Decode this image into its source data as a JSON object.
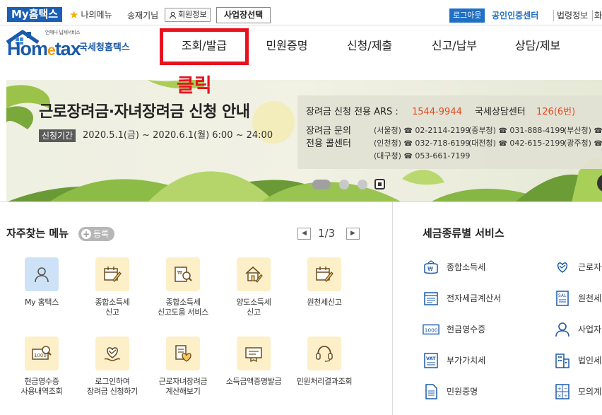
{
  "topbar": {
    "my_hometax": "My홈택스",
    "my_menu": "나의메뉴",
    "user_name": "송재기님",
    "member_info": "회원정보",
    "biz_select": "사업장선택",
    "logout": "로그아웃",
    "cert_center": "공인인증센터",
    "law_info": "법령정보",
    "law_extra": "화"
  },
  "logo": {
    "sub": "언제나 납세서비스",
    "text_a": "Hom",
    "text_e": "e",
    "text_b": "tax",
    "korean": "국세청홈택스"
  },
  "nav": [
    "조회/발급",
    "민원증명",
    "신청/제출",
    "신고/납부",
    "상담/제보"
  ],
  "annotation": {
    "click_note": "클릭"
  },
  "banner": {
    "title": "근로장려금·자녀장려금 신청 안내",
    "period_label": "신청기간",
    "period_text": "2020.5.1(금) ~ 2020.6.1(월) 6:00 ~ 24:00",
    "ars_label": "장려금 신청 전용 ARS :",
    "ars_number": "1544-9944",
    "nts_label": "국세상담센터",
    "nts_number": "126(6번)",
    "call_label_1": "장려금 문의",
    "call_label_2": "전용 콜센터",
    "phones": [
      {
        "region": "(서울청)",
        "number": "02-2114-2199"
      },
      {
        "region": "(중부청)",
        "number": "031-888-4199"
      },
      {
        "region": "(부산청)",
        "number": ""
      },
      {
        "region": "(인천청)",
        "number": "032-718-6199"
      },
      {
        "region": "(대전청)",
        "number": "042-615-2199"
      },
      {
        "region": "(광주청)",
        "number": ""
      },
      {
        "region": "(대구청)",
        "number": "053-661-7199"
      }
    ]
  },
  "favorites": {
    "title": "자주찾는 메뉴",
    "register": "등록",
    "page": "1/3",
    "items": [
      {
        "label_1": "My 홈택스",
        "label_2": "",
        "icon": "person-icon"
      },
      {
        "label_1": "종합소득세",
        "label_2": "신고",
        "icon": "calendar-pen-icon"
      },
      {
        "label_1": "종합소득세",
        "label_2": "신고도움 서비스",
        "icon": "document-search-icon"
      },
      {
        "label_1": "양도소득세",
        "label_2": "신고",
        "icon": "house-pen-icon"
      },
      {
        "label_1": "원천세신고",
        "label_2": "",
        "icon": "calendar-pen-icon"
      },
      {
        "label_1": "현금영수증",
        "label_2": "사용내역조회",
        "icon": "receipt-search-icon"
      },
      {
        "label_1": "로그인하여",
        "label_2": "장려금 신청하기",
        "icon": "heart-hands-icon"
      },
      {
        "label_1": "근로자녀장려금",
        "label_2": "계산해보기",
        "icon": "heart-document-icon"
      },
      {
        "label_1": "소득금액증명발급",
        "label_2": "",
        "icon": "certificate-icon"
      },
      {
        "label_1": "민원처리결과조회",
        "label_2": "",
        "icon": "headset-icon"
      }
    ]
  },
  "tax_services": {
    "title": "세금종류별 서비스",
    "items": [
      {
        "label": "종합소득세",
        "icon": "money-bag-icon"
      },
      {
        "label": "근로자",
        "icon": "heart-hand-icon"
      },
      {
        "label": "전자세금계산서",
        "icon": "invoice-icon"
      },
      {
        "label": "원천세",
        "icon": "sal-document-icon"
      },
      {
        "label": "현금영수증",
        "icon": "receipt-1000-icon"
      },
      {
        "label": "사업자",
        "icon": "person-icon"
      },
      {
        "label": "부가가치세",
        "icon": "vat-icon"
      },
      {
        "label": "법인세",
        "icon": "building-icon"
      },
      {
        "label": "민원증명",
        "icon": "document-icon"
      },
      {
        "label": "모의계",
        "icon": "calculator-icon"
      }
    ]
  },
  "colors": {
    "brand_blue": "#1b5aa8",
    "highlight_red": "#e8121e",
    "accent_orange": "#e8491e",
    "icon_bg": "#fdefc8",
    "icon_stroke": "#7a5a2a"
  }
}
